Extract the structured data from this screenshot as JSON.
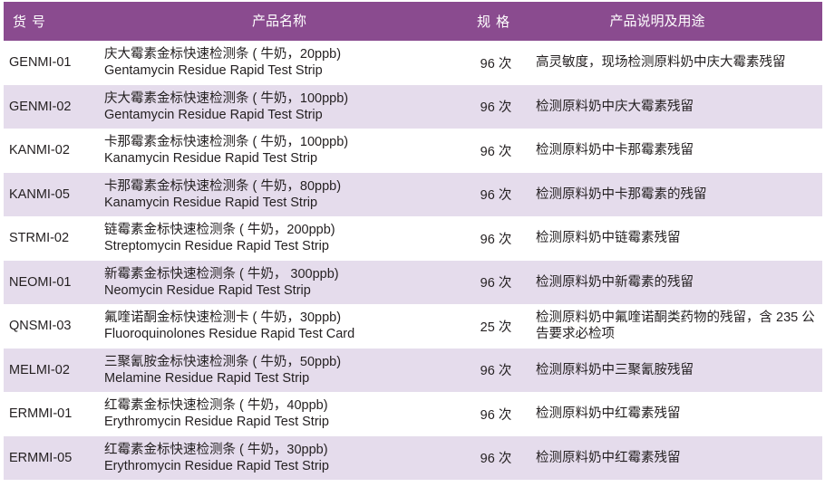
{
  "header": {
    "code": "货号",
    "name": "产品名称",
    "spec": "规格",
    "desc": "产品说明及用途"
  },
  "rows": [
    {
      "code": "GENMI-01",
      "name_cn": "庆大霉素金标快速检测条 ( 牛奶，20ppb)",
      "name_en": "Gentamycin Residue Rapid Test Strip",
      "spec": "96 次",
      "desc": "高灵敏度，现场检测原料奶中庆大霉素残留"
    },
    {
      "code": "GENMI-02",
      "name_cn": "庆大霉素金标快速检测条 ( 牛奶，100ppb)",
      "name_en": "Gentamycin Residue Rapid Test Strip",
      "spec": "96 次",
      "desc": "检测原料奶中庆大霉素残留"
    },
    {
      "code": "KANMI-02",
      "name_cn": "卡那霉素金标快速检测条 ( 牛奶，100ppb)",
      "name_en": "Kanamycin Residue Rapid Test Strip",
      "spec": "96 次",
      "desc": "检测原料奶中卡那霉素残留"
    },
    {
      "code": "KANMI-05",
      "name_cn": "卡那霉素金标快速检测条 ( 牛奶，80ppb)",
      "name_en": "Kanamycin Residue Rapid Test Strip",
      "spec": "96 次",
      "desc": "检测原料奶中卡那霉素的残留"
    },
    {
      "code": "STRMI-02",
      "name_cn": "链霉素金标快速检测条 ( 牛奶，200ppb)",
      "name_en": "Streptomycin Residue Rapid Test Strip",
      "spec": "96 次",
      "desc": "检测原料奶中链霉素残留"
    },
    {
      "code": "NEOMI-01",
      "name_cn": "新霉素金标快速检测条 ( 牛奶， 300ppb)",
      "name_en": "Neomycin Residue Rapid Test Strip",
      "spec": "96 次",
      "desc": "检测原料奶中新霉素的残留"
    },
    {
      "code": "QNSMI-03",
      "name_cn": "氟喹诺酮金标快速检测卡 ( 牛奶，30ppb)",
      "name_en": "Fluoroquinolones Residue Rapid Test Card",
      "spec": "25 次",
      "desc": "检测原料奶中氟喹诺酮类药物的残留，含 235 公告要求必检项"
    },
    {
      "code": "MELMI-02",
      "name_cn": "三聚氰胺金标快速检测条 ( 牛奶，50ppb)",
      "name_en": "Melamine Residue Rapid Test Strip",
      "spec": "96 次",
      "desc": "检测原料奶中三聚氰胺残留"
    },
    {
      "code": "ERMMI-01",
      "name_cn": "红霉素金标快速检测条 ( 牛奶，40ppb)",
      "name_en": "Erythromycin Residue Rapid Test Strip",
      "spec": "96 次",
      "desc": "检测原料奶中红霉素残留"
    },
    {
      "code": "ERMMI-05",
      "name_cn": "红霉素金标快速检测条 ( 牛奶，30ppb)",
      "name_en": "Erythromycin Residue Rapid Test Strip",
      "spec": "96 次",
      "desc": "检测原料奶中红霉素残留"
    }
  ],
  "colors": {
    "header_bg": "#8a4b8f",
    "stripe_bg": "#e5dcec"
  }
}
